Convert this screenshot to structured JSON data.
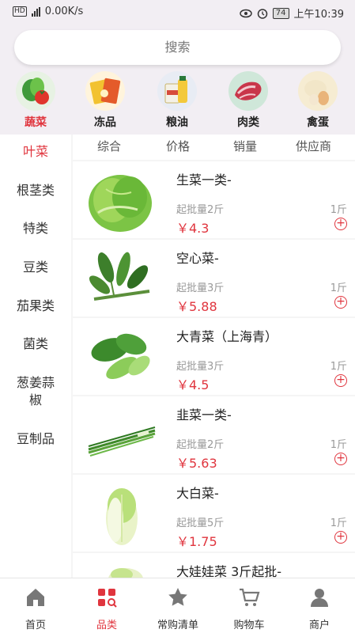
{
  "status_bar": {
    "network": "0.00K/s",
    "battery": "74",
    "time": "上午10:39"
  },
  "search": {
    "placeholder": "搜索"
  },
  "categories": [
    {
      "label": "蔬菜",
      "icon": "vegetables-icon",
      "active": true
    },
    {
      "label": "冻品",
      "icon": "frozen-food-icon",
      "active": false
    },
    {
      "label": "粮油",
      "icon": "grain-oil-icon",
      "active": false
    },
    {
      "label": "肉类",
      "icon": "meat-icon",
      "active": false
    },
    {
      "label": "禽蛋",
      "icon": "poultry-egg-icon",
      "active": false
    }
  ],
  "sidebar": {
    "items": [
      {
        "label": "叶菜",
        "active": true
      },
      {
        "label": "根茎类"
      },
      {
        "label": "特类"
      },
      {
        "label": "豆类"
      },
      {
        "label": "茄果类"
      },
      {
        "label": "菌类"
      },
      {
        "label": "葱姜蒜"
      },
      {
        "label": "椒"
      },
      {
        "label": "豆制品"
      }
    ]
  },
  "sort": {
    "items": [
      "综合",
      "价格",
      "销量",
      "供应商"
    ]
  },
  "products": [
    {
      "name": "生菜一类-",
      "min_order": "起批量2斤",
      "price": "￥4.3",
      "unit": "1斤",
      "add": "+"
    },
    {
      "name": "空心菜-",
      "min_order": "起批量3斤",
      "price": "￥5.88",
      "unit": "1斤",
      "add": "+"
    },
    {
      "name": "大青菜（上海青）",
      "min_order": "起批量3斤",
      "price": "￥4.5",
      "unit": "1斤",
      "add": "+"
    },
    {
      "name": "韭菜一类-",
      "min_order": "起批量2斤",
      "price": "￥5.63",
      "unit": "1斤",
      "add": "+"
    },
    {
      "name": "大白菜-",
      "min_order": "起批量5斤",
      "price": "￥1.75",
      "unit": "1斤",
      "add": "+"
    },
    {
      "name": "大娃娃菜 3斤起批-"
    }
  ],
  "tabbar": {
    "items": [
      {
        "label": "首页",
        "icon": "home-icon"
      },
      {
        "label": "品类",
        "icon": "category-icon",
        "active": true
      },
      {
        "label": "常购清单",
        "icon": "star-icon"
      },
      {
        "label": "购物车",
        "icon": "cart-icon"
      },
      {
        "label": "商户",
        "icon": "user-icon"
      }
    ]
  },
  "colors": {
    "accent": "#e0353e",
    "header_bg": "#f2eef3"
  }
}
